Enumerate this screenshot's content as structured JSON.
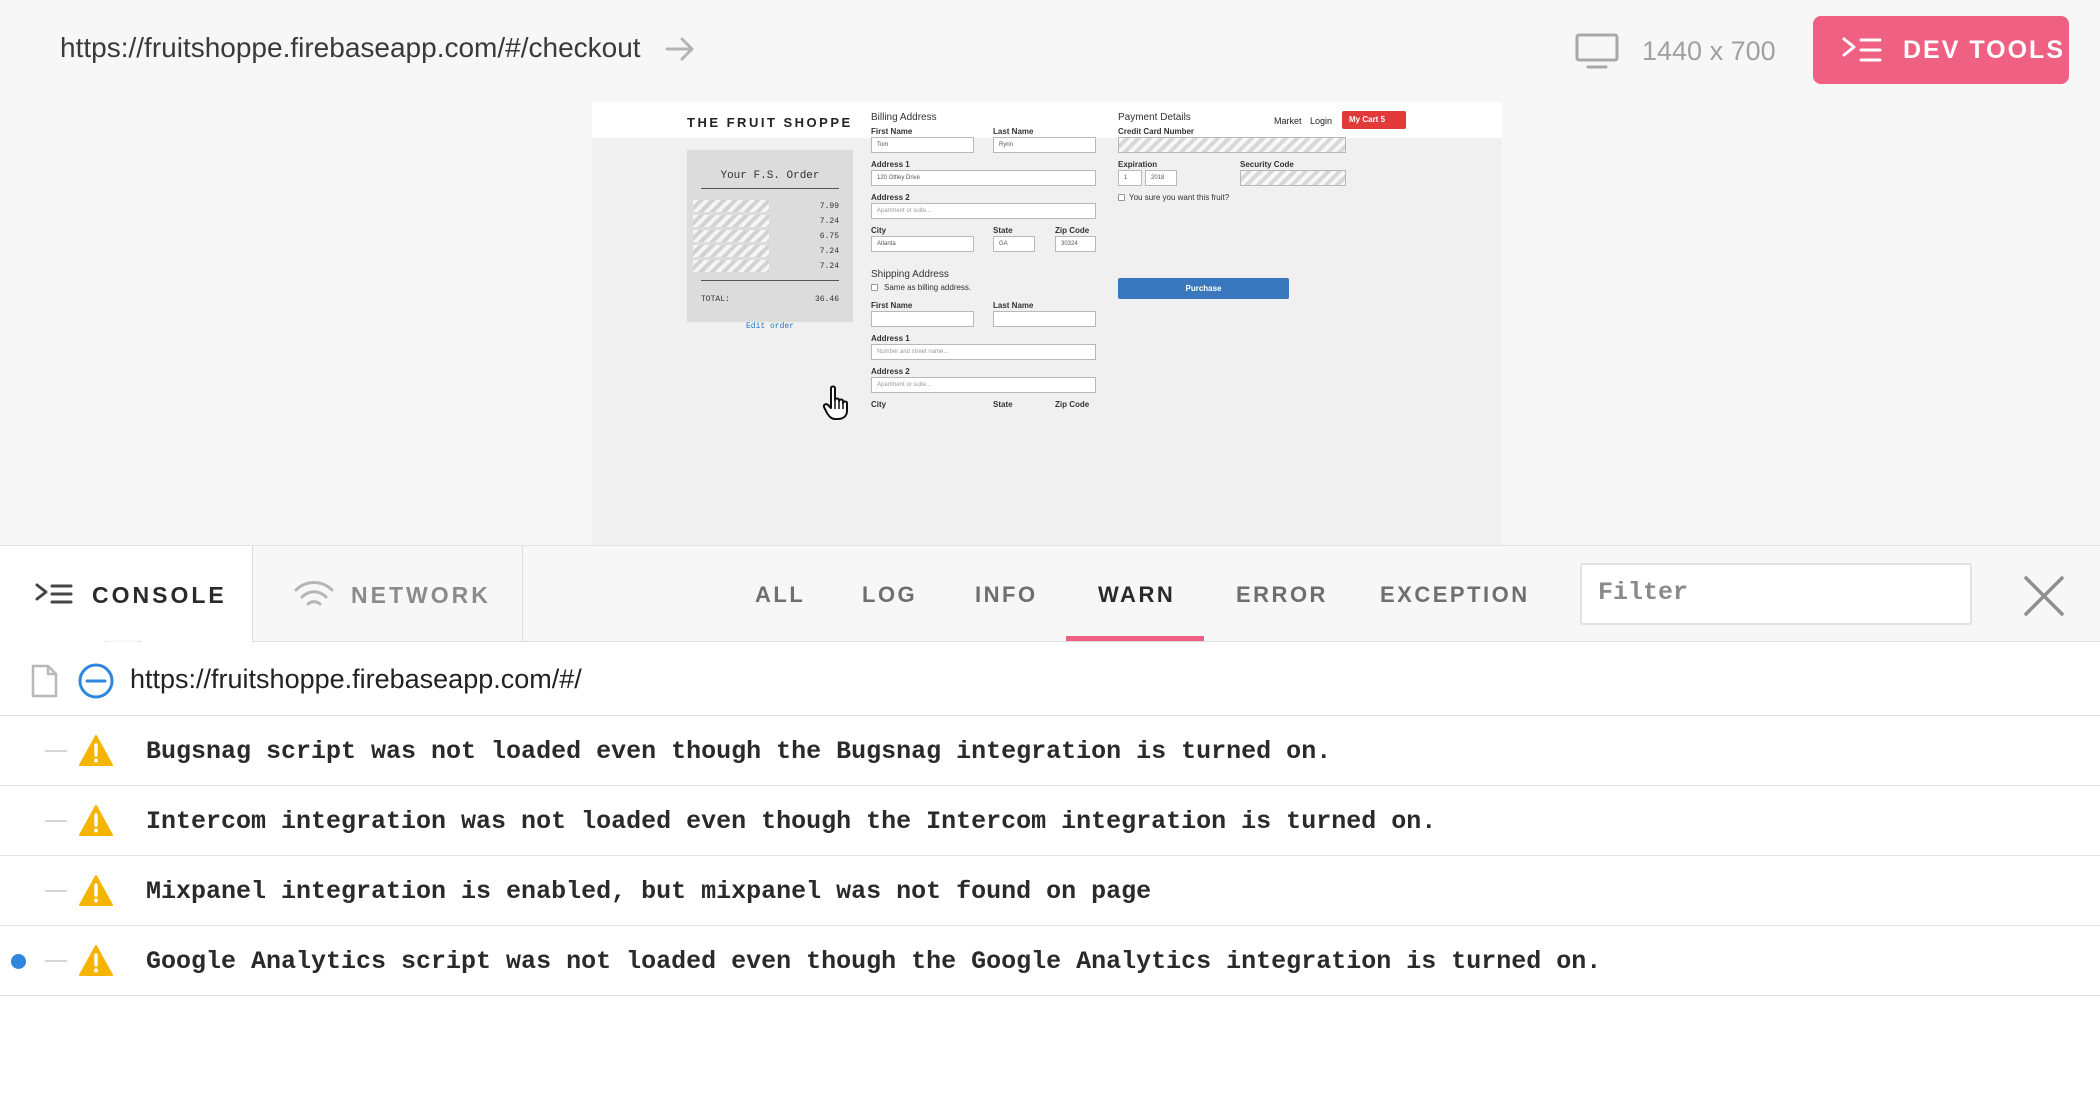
{
  "topbar": {
    "url": "https://fruitshoppe.firebaseapp.com/#/checkout",
    "viewport_size": "1440 x 700",
    "devtools_label": "DEV TOOLS"
  },
  "preview": {
    "brand": "THE FRUIT SHOPPE",
    "nav_market": "Market",
    "nav_login": "Login",
    "cart_label": "My Cart 5",
    "receipt_title": "Your F.S. Order",
    "receipt_prices": [
      "7.99",
      "7.24",
      "6.75",
      "7.24",
      "7.24"
    ],
    "receipt_total_label": "TOTAL:",
    "receipt_total": "36.46",
    "edit_order": "Edit order",
    "billing": {
      "heading": "Billing Address",
      "first_name_label": "First Name",
      "first_name": "Tom",
      "last_name_label": "Last Name",
      "last_name": "Rynn",
      "address1_label": "Address 1",
      "address1": "120 Ottley Drive",
      "address2_label": "Address 2",
      "address2_placeholder": "Apartment or suite...",
      "city_label": "City",
      "city": "Atlanta",
      "state_label": "State",
      "state": "GA",
      "zip_label": "Zip Code",
      "zip": "30324"
    },
    "shipping": {
      "heading": "Shipping Address",
      "same_as_billing": "Same as billing address.",
      "first_name_label": "First Name",
      "last_name_label": "Last Name",
      "address1_label": "Address 1",
      "address1_placeholder": "Number and street name...",
      "address2_label": "Address 2",
      "address2_placeholder": "Apartment or suite...",
      "city_label": "City",
      "state_label": "State",
      "zip_label": "Zip Code"
    },
    "payment": {
      "heading": "Payment Details",
      "card_label": "Credit Card Number",
      "expiration_label": "Expiration",
      "exp_month": "1",
      "exp_year": "2018",
      "security_label": "Security Code",
      "confirm_text": "You sure you want this fruit?",
      "purchase_label": "Purchase"
    }
  },
  "devtools": {
    "tabs": {
      "console": "CONSOLE",
      "network": "NETWORK"
    },
    "levels": [
      "ALL",
      "LOG",
      "INFO",
      "WARN",
      "ERROR",
      "EXCEPTION"
    ],
    "active_level": "WARN",
    "filter_placeholder": "Filter",
    "page_url": "https://fruitshoppe.firebaseapp.com/#/",
    "logs": [
      "Bugsnag script was not loaded even though the Bugsnag integration is turned on.",
      "Intercom integration was not loaded even though the Intercom integration is turned on.",
      "Mixpanel integration is enabled, but mixpanel was not found on page",
      "Google Analytics script was not loaded even though the Google Analytics integration is turned on."
    ]
  },
  "colors": {
    "accent": "#ef6082",
    "warning": "#f5b400",
    "link": "#2e86de"
  }
}
